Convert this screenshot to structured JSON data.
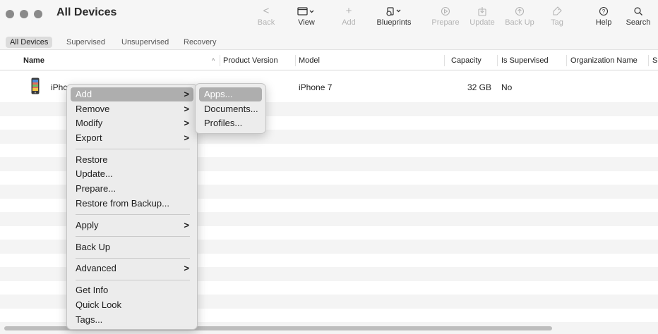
{
  "window": {
    "title": "All Devices"
  },
  "toolbar": {
    "back": {
      "label": "Back",
      "icon": "chevron-left-icon",
      "glyph": "<"
    },
    "view": {
      "label": "View",
      "icon": "window-icon"
    },
    "add": {
      "label": "Add",
      "icon": "plus-icon",
      "glyph": "+"
    },
    "blueprints": {
      "label": "Blueprints",
      "icon": "blueprints-icon"
    },
    "prepare": {
      "label": "Prepare",
      "icon": "prepare-icon"
    },
    "update": {
      "label": "Update",
      "icon": "update-icon"
    },
    "backup": {
      "label": "Back Up",
      "icon": "backup-icon"
    },
    "tag": {
      "label": "Tag",
      "icon": "tag-icon"
    },
    "help": {
      "label": "Help",
      "icon": "help-icon",
      "glyph": "?"
    },
    "search": {
      "label": "Search",
      "icon": "search-icon"
    }
  },
  "scopes": [
    {
      "label": "All Devices",
      "active": true
    },
    {
      "label": "Supervised",
      "active": false
    },
    {
      "label": "Unsupervised",
      "active": false
    },
    {
      "label": "Recovery",
      "active": false
    }
  ],
  "columns": {
    "name": "Name",
    "sort_glyph": "^",
    "product_version": "Product Version",
    "model": "Model",
    "capacity": "Capacity",
    "is_supervised": "Is Supervised",
    "organization_name": "Organization Name",
    "truncated": "S"
  },
  "devices": [
    {
      "name": "iPhc",
      "product_version": "",
      "model": "iPhone 7",
      "capacity": "32 GB",
      "is_supervised": "No",
      "organization_name": ""
    }
  ],
  "context_menu": {
    "add": "Add",
    "remove": "Remove",
    "modify": "Modify",
    "export": "Export",
    "restore": "Restore",
    "update": "Update...",
    "prepare": "Prepare...",
    "restore_from_backup": "Restore from Backup...",
    "apply": "Apply",
    "back_up": "Back Up",
    "advanced": "Advanced",
    "get_info": "Get Info",
    "quick_look": "Quick Look",
    "tags": "Tags...",
    "arrow": ">"
  },
  "submenu": {
    "apps": "Apps...",
    "documents": "Documents...",
    "profiles": "Profiles..."
  },
  "colors": {
    "highlight": "#aeaeae",
    "toolbar_bg": "#f6f6f6",
    "traffic_light": "#8a8a8a",
    "disabled_text": "#b4b4b4"
  }
}
